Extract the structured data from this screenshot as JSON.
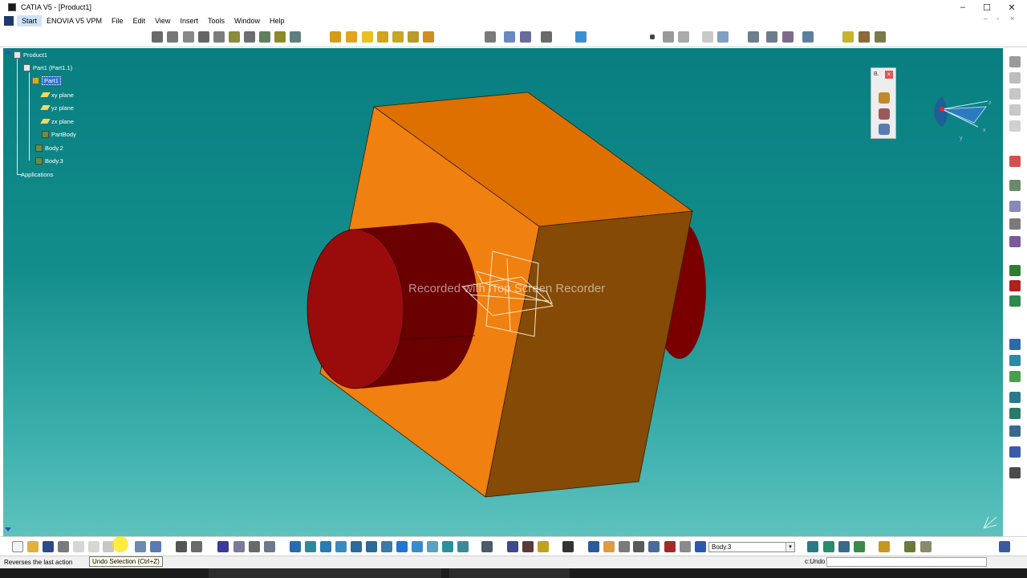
{
  "window": {
    "title": "CATIA V5 - [Product1]",
    "minimize": "–",
    "maximize": "☐",
    "close": "✕"
  },
  "menu": {
    "items": [
      "Start",
      "ENOVIA V5 VPM",
      "File",
      "Edit",
      "View",
      "Insert",
      "Tools",
      "Window",
      "Help"
    ],
    "mdi_controls": {
      "minimize": "–",
      "restore": "▫",
      "close": "×"
    }
  },
  "tree": {
    "product": "Product1",
    "instance": "Part1 (Part1.1)",
    "part": "Part1",
    "planes": [
      "xy plane",
      "yz plane",
      "zx plane"
    ],
    "bodies": [
      "PartBody",
      "Body.2",
      "Body.3"
    ],
    "applications": "Applications"
  },
  "mini_toolbar": {
    "title": "B.",
    "close": "×"
  },
  "watermark": "Recorded with iTop Screen Recorder",
  "compass": {
    "axis_x": "x",
    "axis_y": "y",
    "axis_z": "z"
  },
  "bottom": {
    "current_body": "Body.3"
  },
  "status": {
    "message": "Reverses the last action",
    "tooltip": "Undo Selection (Ctrl+Z)",
    "power_input_label": "c:Undo",
    "power_input_value": ""
  },
  "colors": {
    "viewport_top": "#087e80",
    "viewport_bottom": "#5ec2bd",
    "block_top": "#de7000",
    "block_front": "#f08010",
    "block_side": "#844a06",
    "cylinder_face": "#9a0c0c",
    "cylinder_side": "#6a0000",
    "selection": "#2a6fd6"
  }
}
